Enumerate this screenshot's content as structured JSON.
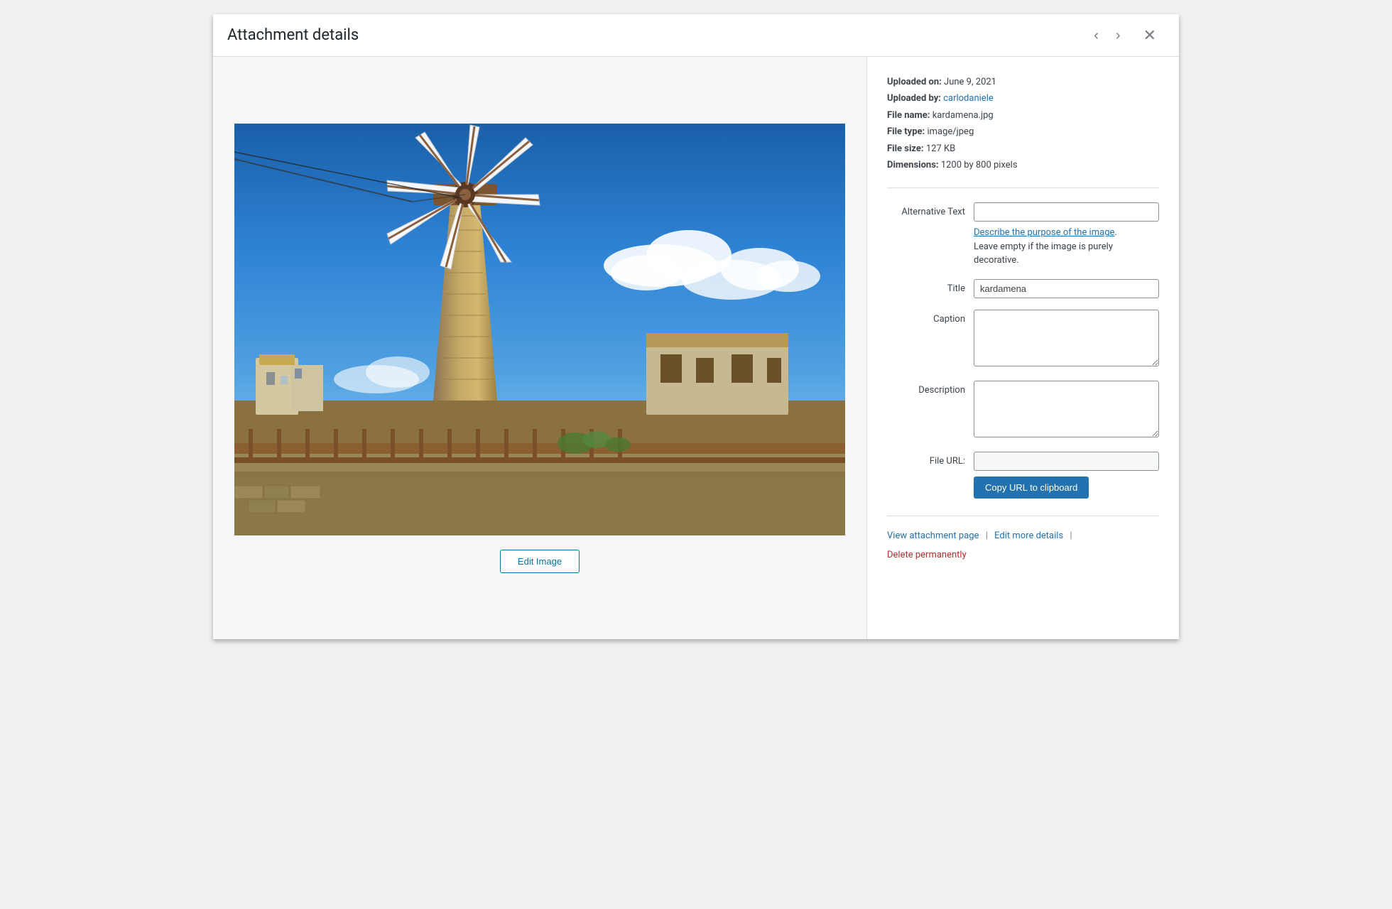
{
  "modal": {
    "title": "Attachment details",
    "nav_prev_label": "‹",
    "nav_next_label": "›",
    "close_label": "✕"
  },
  "file_info": {
    "uploaded_on_label": "Uploaded on:",
    "uploaded_on_value": "June 9, 2021",
    "uploaded_by_label": "Uploaded by:",
    "uploaded_by_value": "carlodaniele",
    "file_name_label": "File name:",
    "file_name_value": "kardamena.jpg",
    "file_type_label": "File type:",
    "file_type_value": "image/jpeg",
    "file_size_label": "File size:",
    "file_size_value": "127 KB",
    "dimensions_label": "Dimensions:",
    "dimensions_value": "1200 by 800 pixels"
  },
  "form": {
    "alt_text_label": "Alternative Text",
    "alt_text_value": "",
    "alt_text_link": "Describe the purpose of the image",
    "alt_text_hint": "Leave empty if the image is purely decorative.",
    "title_label": "Title",
    "title_value": "kardamena",
    "caption_label": "Caption",
    "caption_value": "",
    "description_label": "Description",
    "description_value": "",
    "file_url_label": "File URL:",
    "file_url_value": ""
  },
  "buttons": {
    "edit_image": "Edit Image",
    "copy_url": "Copy URL to clipboard"
  },
  "footer": {
    "view_attachment_label": "View attachment page",
    "edit_details_label": "Edit more details",
    "delete_label": "Delete permanently"
  }
}
